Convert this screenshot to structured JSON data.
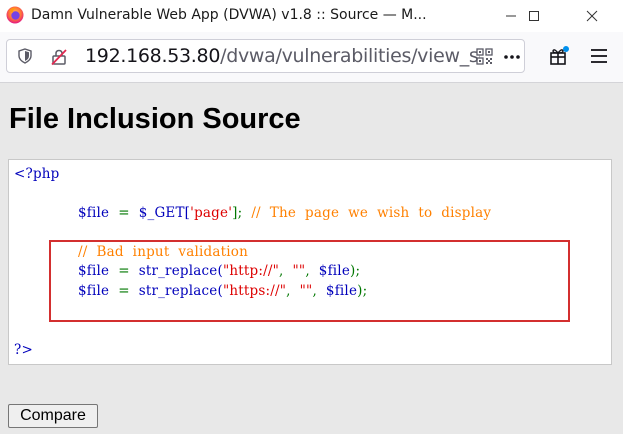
{
  "window": {
    "title": "Damn Vulnerable Web App (DVWA) v1.8 :: Source — M..."
  },
  "nav": {
    "url_host": "192.168.53.80",
    "url_path": "/dvwa/vulnerabilities/view_source",
    "icons": [
      "shield-icon",
      "insecure-lock-icon",
      "qr-code-icon",
      "more-icon",
      "extensions-icon",
      "hamburger-menu-icon"
    ]
  },
  "page": {
    "title": "File Inclusion Source"
  },
  "code": {
    "open_tag": "<?php",
    "line1_var": "$file",
    "line1_eq": "=",
    "line1_get": "$_GET[",
    "line1_key": "'page'",
    "line1_close": "];",
    "line1_comment": "//  The  page  we  wish  to  display",
    "comment2": "//  Bad  input  validation",
    "line2_var": "$file",
    "line2_eq": "=",
    "line2_fn": "str_replace(",
    "line2_arg1": "\"http://\"",
    "line2_sep1": ",",
    "line2_arg2": "\"\"",
    "line2_sep2": ",",
    "line2_arg3": "$file",
    "line2_end": ");",
    "line3_var": "$file",
    "line3_eq": "=",
    "line3_fn": "str_replace(",
    "line3_arg1": "\"https://\"",
    "line3_sep1": ",",
    "line3_arg2": "\"\"",
    "line3_sep2": ",",
    "line3_arg3": "$file",
    "line3_end": ");",
    "close_tag": "?>"
  },
  "actions": {
    "compare_label": "Compare"
  },
  "colors": {
    "php_blue": "#0000bb",
    "php_green": "#007700",
    "php_red": "#dd0000",
    "php_comment": "#ff8000",
    "highlight_box": "#d32f2f"
  }
}
